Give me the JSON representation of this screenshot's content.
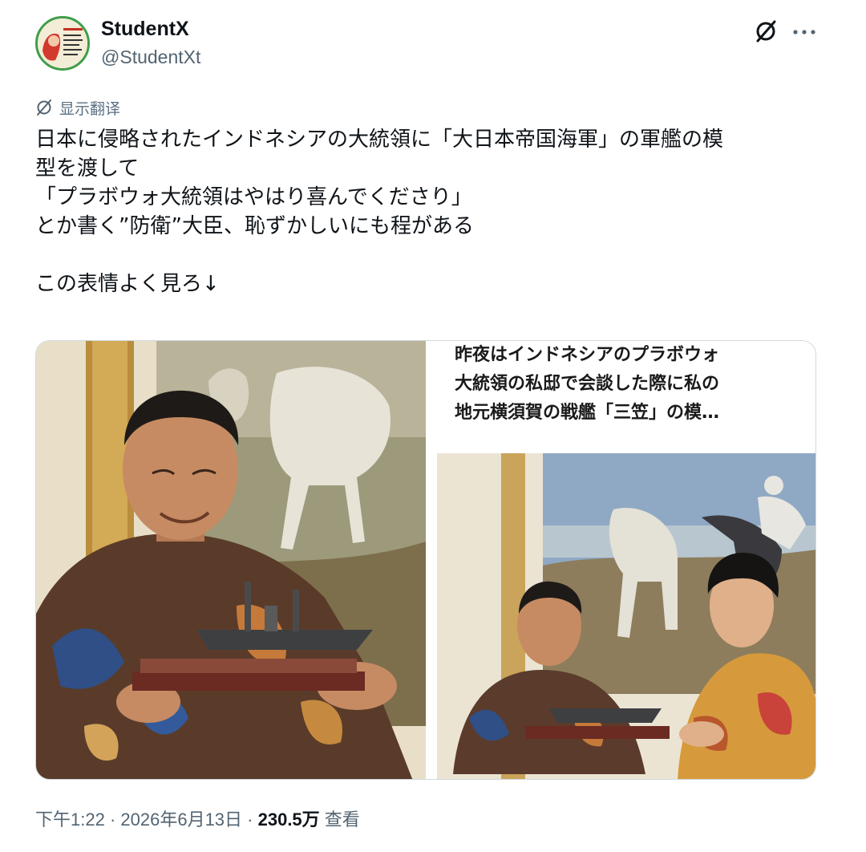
{
  "author": {
    "name": "StudentX",
    "handle": "@StudentXt"
  },
  "header_icons": {
    "grok": "grok-icon",
    "more": "more-icon"
  },
  "translate": {
    "label": "显示翻译",
    "icon": "translate-icon"
  },
  "tweet": {
    "lines": [
      "日本に侵略されたインドネシアの大統領に「大日本帝国海軍」の軍艦の模",
      "型を渡して",
      "「プラボウォ大統領はやはり喜んでくださり」",
      "とか書く”防衛”大臣、恥ずかしいにも程がある",
      "",
      "この表情よく見ろ↓"
    ]
  },
  "media": {
    "right_caption": [
      "昨夜はインドネシアのプラボウォ",
      "大統領の私邸で会談した際に私の",
      "地元横須賀の戦艦「三笠」の模…"
    ]
  },
  "meta": {
    "time": "下午1:22",
    "sep1": " · ",
    "date": "2026年6月13日",
    "sep2": " · ",
    "views": "230.5万",
    "views_label": " 查看"
  },
  "colors": {
    "text": "#0f1419",
    "secondary": "#536471",
    "border": "#cfd9de"
  }
}
